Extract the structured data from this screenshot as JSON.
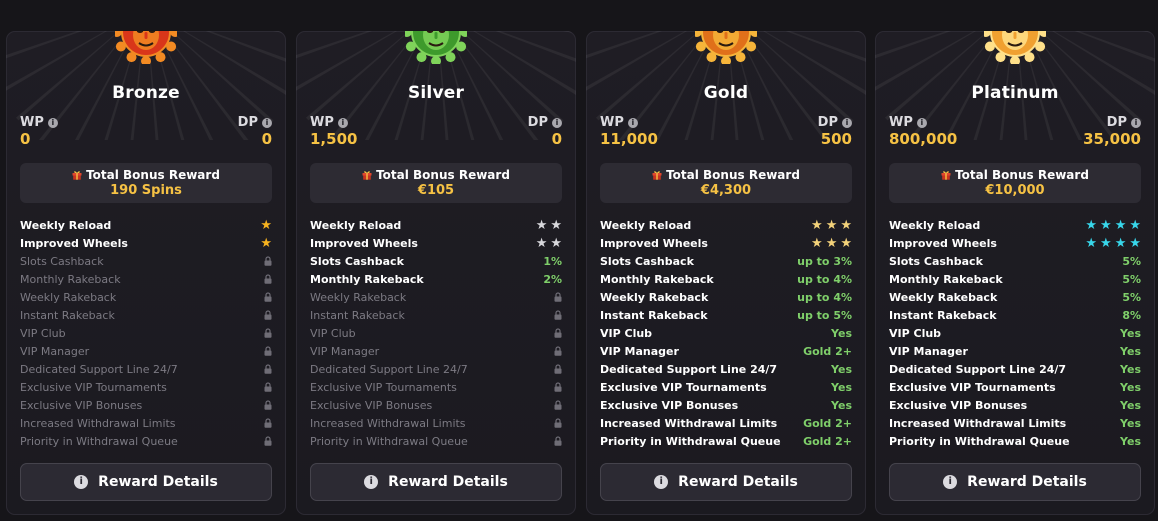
{
  "common": {
    "wp_label": "WP",
    "dp_label": "DP",
    "bonus_title": "Total Bonus Reward",
    "button_label": "Reward Details",
    "info_glyph": "i",
    "colors": {
      "gold": "#f6c244",
      "green": "#7fcf6a",
      "dim": "#7c7a83",
      "cyan": "#38d6ea"
    }
  },
  "tiers": [
    {
      "name": "Bronze",
      "mask_color": "#d9361a",
      "mask_accent": "#f28a23",
      "wp": "0",
      "dp": "0",
      "bonus": "190 Spins",
      "features": [
        {
          "label": "Weekly Reload",
          "value": "",
          "stars": 1,
          "locked": false
        },
        {
          "label": "Improved Wheels",
          "value": "",
          "stars": 1,
          "locked": false
        },
        {
          "label": "Slots Cashback",
          "value": "",
          "stars": 0,
          "locked": true
        },
        {
          "label": "Monthly Rakeback",
          "value": "",
          "stars": 0,
          "locked": true
        },
        {
          "label": "Weekly Rakeback",
          "value": "",
          "stars": 0,
          "locked": true
        },
        {
          "label": "Instant Rakeback",
          "value": "",
          "stars": 0,
          "locked": true
        },
        {
          "label": "VIP Club",
          "value": "",
          "stars": 0,
          "locked": true
        },
        {
          "label": "VIP Manager",
          "value": "",
          "stars": 0,
          "locked": true
        },
        {
          "label": "Dedicated Support Line 24/7",
          "value": "",
          "stars": 0,
          "locked": true
        },
        {
          "label": "Exclusive VIP Tournaments",
          "value": "",
          "stars": 0,
          "locked": true
        },
        {
          "label": "Exclusive VIP Bonuses",
          "value": "",
          "stars": 0,
          "locked": true
        },
        {
          "label": "Increased Withdrawal Limits",
          "value": "",
          "stars": 0,
          "locked": true
        },
        {
          "label": "Priority in Withdrawal Queue",
          "value": "",
          "stars": 0,
          "locked": true
        }
      ],
      "star_color": "#f6b21f"
    },
    {
      "name": "Silver",
      "mask_color": "#3e9a2c",
      "mask_accent": "#7fd35a",
      "wp": "1,500",
      "dp": "0",
      "bonus": "€105",
      "features": [
        {
          "label": "Weekly Reload",
          "value": "",
          "stars": 2,
          "locked": false
        },
        {
          "label": "Improved Wheels",
          "value": "",
          "stars": 2,
          "locked": false
        },
        {
          "label": "Slots Cashback",
          "value": "1%",
          "stars": 0,
          "locked": false
        },
        {
          "label": "Monthly Rakeback",
          "value": "2%",
          "stars": 0,
          "locked": false
        },
        {
          "label": "Weekly Rakeback",
          "value": "",
          "stars": 0,
          "locked": true
        },
        {
          "label": "Instant Rakeback",
          "value": "",
          "stars": 0,
          "locked": true
        },
        {
          "label": "VIP Club",
          "value": "",
          "stars": 0,
          "locked": true
        },
        {
          "label": "VIP Manager",
          "value": "",
          "stars": 0,
          "locked": true
        },
        {
          "label": "Dedicated Support Line 24/7",
          "value": "",
          "stars": 0,
          "locked": true
        },
        {
          "label": "Exclusive VIP Tournaments",
          "value": "",
          "stars": 0,
          "locked": true
        },
        {
          "label": "Exclusive VIP Bonuses",
          "value": "",
          "stars": 0,
          "locked": true
        },
        {
          "label": "Increased Withdrawal Limits",
          "value": "",
          "stars": 0,
          "locked": true
        },
        {
          "label": "Priority in Withdrawal Queue",
          "value": "",
          "stars": 0,
          "locked": true
        }
      ],
      "star_color": "#d8d8dc"
    },
    {
      "name": "Gold",
      "mask_color": "#e0701a",
      "mask_accent": "#f6b43a",
      "wp": "11,000",
      "dp": "500",
      "bonus": "€4,300",
      "features": [
        {
          "label": "Weekly Reload",
          "value": "",
          "stars": 3,
          "locked": false
        },
        {
          "label": "Improved Wheels",
          "value": "",
          "stars": 3,
          "locked": false
        },
        {
          "label": "Slots Cashback",
          "value": "up to 3%",
          "stars": 0,
          "locked": false
        },
        {
          "label": "Monthly Rakeback",
          "value": "up to 4%",
          "stars": 0,
          "locked": false
        },
        {
          "label": "Weekly Rakeback",
          "value": "up to 4%",
          "stars": 0,
          "locked": false
        },
        {
          "label": "Instant Rakeback",
          "value": "up to 5%",
          "stars": 0,
          "locked": false
        },
        {
          "label": "VIP Club",
          "value": "Yes",
          "stars": 0,
          "locked": false
        },
        {
          "label": "VIP Manager",
          "value": "Gold 2+",
          "stars": 0,
          "locked": false
        },
        {
          "label": "Dedicated Support Line 24/7",
          "value": "Yes",
          "stars": 0,
          "locked": false
        },
        {
          "label": "Exclusive VIP Tournaments",
          "value": "Yes",
          "stars": 0,
          "locked": false
        },
        {
          "label": "Exclusive VIP Bonuses",
          "value": "Yes",
          "stars": 0,
          "locked": false
        },
        {
          "label": "Increased Withdrawal Limits",
          "value": "Gold 2+",
          "stars": 0,
          "locked": false
        },
        {
          "label": "Priority in Withdrawal Queue",
          "value": "Gold 2+",
          "stars": 0,
          "locked": false
        }
      ],
      "star_color": "#f3d27a"
    },
    {
      "name": "Platinum",
      "mask_color": "#f0a030",
      "mask_accent": "#ffe08a",
      "wp": "800,000",
      "dp": "35,000",
      "bonus": "€10,000",
      "features": [
        {
          "label": "Weekly Reload",
          "value": "",
          "stars": 4,
          "locked": false
        },
        {
          "label": "Improved Wheels",
          "value": "",
          "stars": 4,
          "locked": false
        },
        {
          "label": "Slots Cashback",
          "value": "5%",
          "stars": 0,
          "locked": false
        },
        {
          "label": "Monthly Rakeback",
          "value": "5%",
          "stars": 0,
          "locked": false
        },
        {
          "label": "Weekly Rakeback",
          "value": "5%",
          "stars": 0,
          "locked": false
        },
        {
          "label": "Instant Rakeback",
          "value": "8%",
          "stars": 0,
          "locked": false
        },
        {
          "label": "VIP Club",
          "value": "Yes",
          "stars": 0,
          "locked": false
        },
        {
          "label": "VIP Manager",
          "value": "Yes",
          "stars": 0,
          "locked": false
        },
        {
          "label": "Dedicated Support Line 24/7",
          "value": "Yes",
          "stars": 0,
          "locked": false
        },
        {
          "label": "Exclusive VIP Tournaments",
          "value": "Yes",
          "stars": 0,
          "locked": false
        },
        {
          "label": "Exclusive VIP Bonuses",
          "value": "Yes",
          "stars": 0,
          "locked": false
        },
        {
          "label": "Increased Withdrawal Limits",
          "value": "Yes",
          "stars": 0,
          "locked": false
        },
        {
          "label": "Priority in Withdrawal Queue",
          "value": "Yes",
          "stars": 0,
          "locked": false
        }
      ],
      "star_color": "#38d6ea"
    }
  ]
}
